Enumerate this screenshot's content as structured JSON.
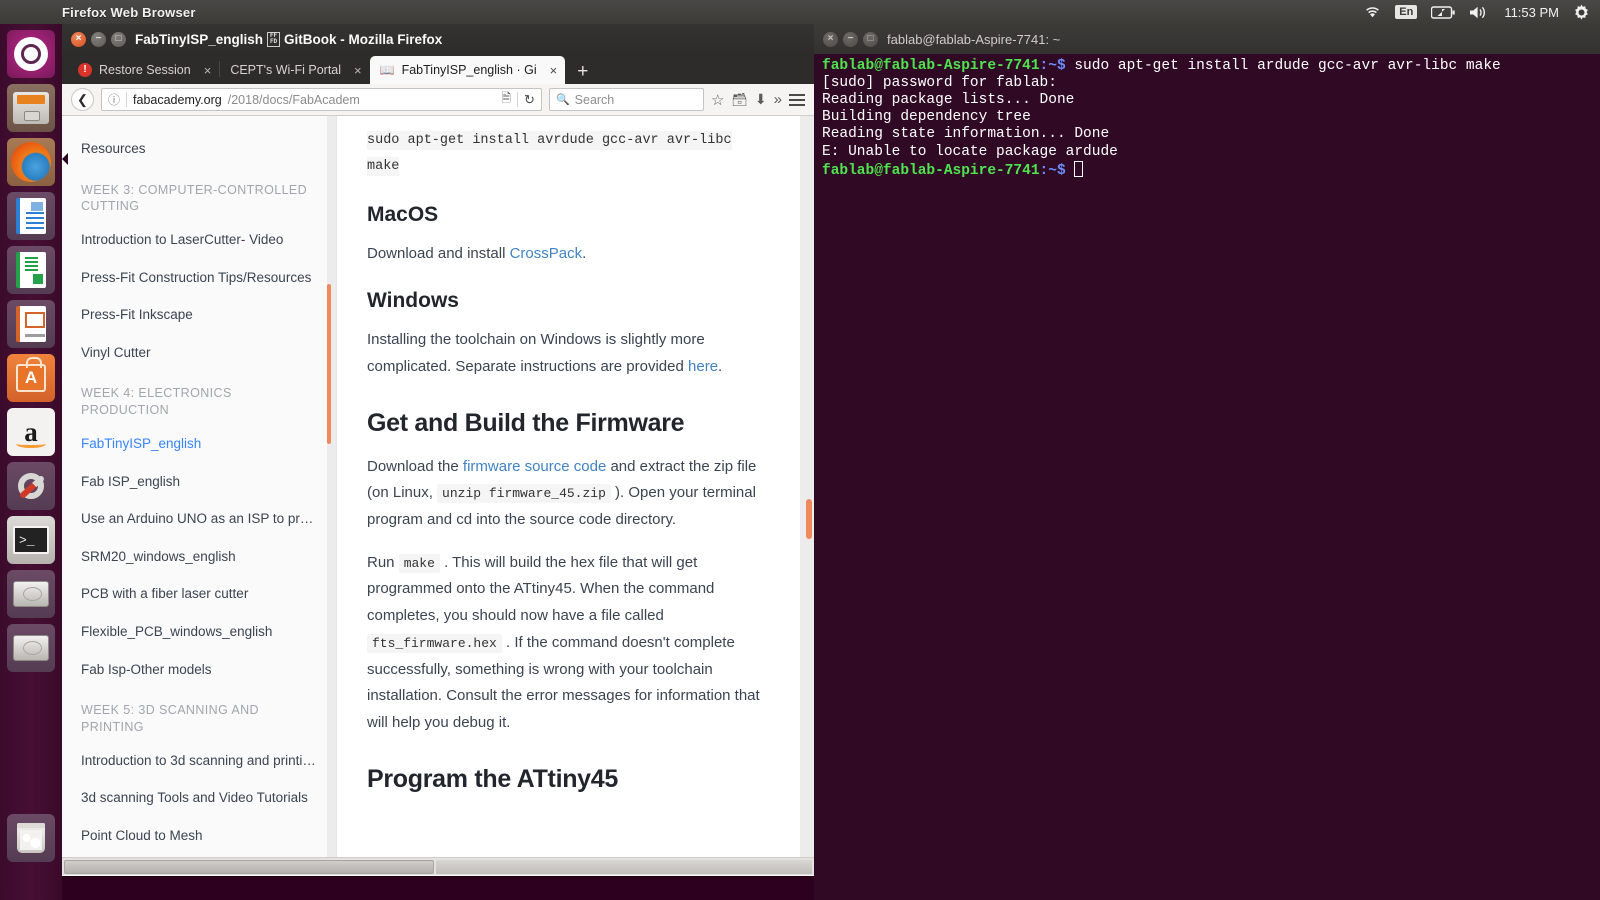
{
  "top_panel": {
    "app_menu_title": "Firefox Web Browser",
    "tray": {
      "wifi_icon": "wifi-icon",
      "keyboard_layout": "En",
      "battery_icon": "battery-charging-icon",
      "volume_icon": "volume-icon",
      "clock": "11:53 PM",
      "settings_icon": "gear-icon"
    }
  },
  "launcher": {
    "items": [
      {
        "name": "ubuntu-dash",
        "label": "Ubuntu Dash",
        "running": false
      },
      {
        "name": "files",
        "label": "Files",
        "running": true
      },
      {
        "name": "firefox",
        "label": "Firefox Web Browser",
        "running": true,
        "focused": true
      },
      {
        "name": "libreoffice-writer",
        "label": "LibreOffice Writer",
        "running": false
      },
      {
        "name": "libreoffice-calc",
        "label": "LibreOffice Calc",
        "running": false
      },
      {
        "name": "libreoffice-impress",
        "label": "LibreOffice Impress",
        "running": false
      },
      {
        "name": "ubuntu-software",
        "label": "Ubuntu Software",
        "running": false
      },
      {
        "name": "amazon",
        "label": "Amazon",
        "running": false
      },
      {
        "name": "system-settings",
        "label": "System Settings",
        "running": false
      },
      {
        "name": "terminal",
        "label": "Terminal",
        "running": true
      },
      {
        "name": "disk-volume-1",
        "label": "Disk Volume",
        "running": false
      },
      {
        "name": "disk-volume-2",
        "label": "Disk Volume",
        "running": false
      },
      {
        "name": "trash",
        "label": "Trash",
        "running": false
      }
    ]
  },
  "firefox": {
    "window_title": "FabTinyISP_english",
    "window_title_suffix": "GitBook - Mozilla Firefox",
    "window_controls": {
      "close": "×",
      "minimize": "−",
      "maximize": "□"
    },
    "tabs": [
      {
        "label": "Restore Session",
        "icon": "warning-icon",
        "close": "×",
        "active": false
      },
      {
        "label": "CEPT's Wi-Fi Portal",
        "icon": "none",
        "close": "×",
        "active": false
      },
      {
        "label": "FabTinyISP_english · Gi",
        "icon": "book-icon",
        "close": "×",
        "active": true
      }
    ],
    "new_tab_label": "+",
    "navbar": {
      "back_icon": "back-arrow-icon",
      "info_icon": "page-info-icon",
      "url_host": "fabacademy.org",
      "url_path": "/2018/docs/FabAcadem",
      "reader_icon": "reader-view-icon",
      "reload_icon": "reload-icon",
      "search_placeholder": "Search",
      "search_icon": "search-icon",
      "bookmark_icon": "star-icon",
      "library_icon": "library-icon",
      "downloads_icon": "download-arrow-icon",
      "overflow_icon": "chevron-double-right-icon",
      "menu_icon": "hamburger-menu-icon"
    }
  },
  "gitbook": {
    "sidebar": [
      {
        "type": "item",
        "label": "Resources",
        "active": false
      },
      {
        "type": "heading",
        "label": "WEEK 3: COMPUTER-CONTROLLED CUTTING"
      },
      {
        "type": "item",
        "label": "Introduction to LaserCutter- Video",
        "active": false
      },
      {
        "type": "item",
        "label": "Press-Fit Construction Tips/Resources",
        "active": false
      },
      {
        "type": "item",
        "label": "Press-Fit Inkscape",
        "active": false
      },
      {
        "type": "item",
        "label": "Vinyl Cutter",
        "active": false
      },
      {
        "type": "heading",
        "label": "WEEK 4: ELECTRONICS PRODUCTION"
      },
      {
        "type": "item",
        "label": "FabTinyISP_english",
        "active": true
      },
      {
        "type": "item",
        "label": "Fab ISP_english",
        "active": false
      },
      {
        "type": "item",
        "label": "Use an Arduino UNO as an ISP to pr…",
        "active": false
      },
      {
        "type": "item",
        "label": "SRM20_windows_english",
        "active": false
      },
      {
        "type": "item",
        "label": "PCB with a fiber laser cutter",
        "active": false
      },
      {
        "type": "item",
        "label": "Flexible_PCB_windows_english",
        "active": false
      },
      {
        "type": "item",
        "label": "Fab Isp-Other models",
        "active": false
      },
      {
        "type": "heading",
        "label": "WEEK 5: 3D SCANNING AND PRINTING"
      },
      {
        "type": "item",
        "label": "Introduction to 3d scanning and printi…",
        "active": false
      },
      {
        "type": "item",
        "label": "3d scanning Tools and Video Tutorials",
        "active": false
      },
      {
        "type": "item",
        "label": "Point Cloud to Mesh",
        "active": false
      }
    ],
    "content": {
      "code_block_line1": "sudo apt-get install avrdude gcc-avr avr-libc",
      "code_block_line2": "make",
      "macos_heading": "MacOS",
      "macos_text_before": "Download and install ",
      "macos_link": "CrossPack",
      "macos_text_after": ".",
      "windows_heading": "Windows",
      "windows_text_before": "Installing the toolchain on Windows is slightly more complicated. Separate instructions are provided ",
      "windows_link": "here",
      "windows_text_after": ".",
      "firmware_heading": "Get and Build the Firmware",
      "p1_a": "Download the ",
      "p1_link": "firmware source code",
      "p1_b": " and extract the zip file (on Linux, ",
      "p1_code": "unzip firmware_45.zip",
      "p1_c": " ). Open your terminal program and cd into the source code directory.",
      "p2_a": "Run ",
      "p2_code1": "make",
      "p2_b": " . This will build the hex file that will get programmed onto the ATtiny45. When the command completes, you should now have a file called ",
      "p2_code2": "fts_firmware.hex",
      "p2_c": " . If the command doesn't complete successfully, something is wrong with your toolchain installation. Consult the error messages for information that will help you debug it.",
      "program_heading": "Program the ATtiny45"
    }
  },
  "terminal": {
    "title": "fablab@fablab-Aspire-7741: ~",
    "window_controls": {
      "close": "×",
      "minimize": "−",
      "maximize": "□"
    },
    "lines": [
      {
        "type": "prompt",
        "user": "fablab@fablab-Aspire-7741",
        "path": ":~$",
        "cmd": " sudo apt-get install ardude gcc-avr avr-libc make"
      },
      {
        "type": "out",
        "text": "[sudo] password for fablab:"
      },
      {
        "type": "out",
        "text": "Reading package lists... Done"
      },
      {
        "type": "out",
        "text": "Building dependency tree"
      },
      {
        "type": "out",
        "text": "Reading state information... Done"
      },
      {
        "type": "out",
        "text": "E: Unable to locate package ardude"
      },
      {
        "type": "prompt_cursor",
        "user": "fablab@fablab-Aspire-7741",
        "path": ":~$",
        "cmd": " "
      }
    ]
  },
  "colors": {
    "ubuntu_purple": "#2c001e",
    "terminal_bg": "#300a24",
    "accent_orange": "#f08a5d",
    "link_blue": "#4183c4",
    "active_sidebar_blue": "#3884ff",
    "prompt_green": "#4ee44e",
    "prompt_blue": "#6d8cff"
  }
}
